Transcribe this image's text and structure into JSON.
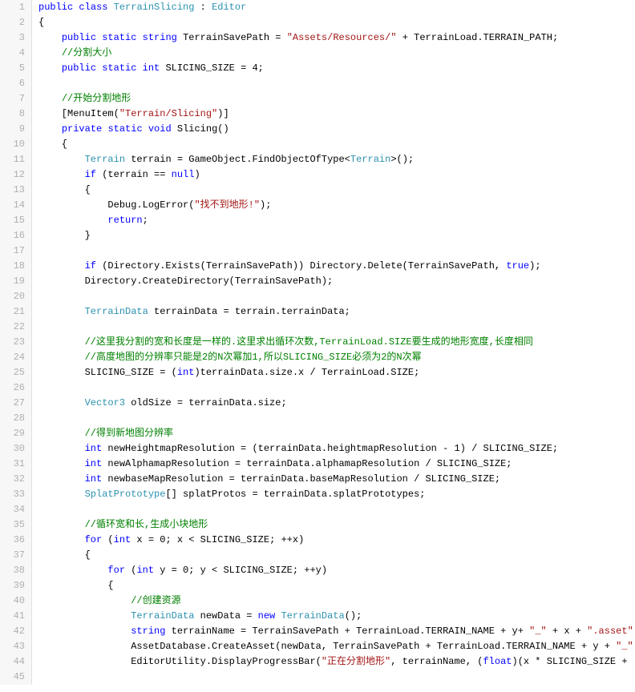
{
  "lines": [
    {
      "num": "1",
      "tokens": [
        {
          "t": "public",
          "c": "kw"
        },
        {
          "t": " "
        },
        {
          "t": "class",
          "c": "kw"
        },
        {
          "t": " "
        },
        {
          "t": "TerrainSlicing",
          "c": "cls"
        },
        {
          "t": " : "
        },
        {
          "t": "Editor",
          "c": "cls"
        }
      ]
    },
    {
      "num": "2",
      "tokens": [
        {
          "t": "{"
        }
      ]
    },
    {
      "num": "3",
      "tokens": [
        {
          "t": "    "
        },
        {
          "t": "public",
          "c": "kw"
        },
        {
          "t": " "
        },
        {
          "t": "static",
          "c": "kw"
        },
        {
          "t": " "
        },
        {
          "t": "string",
          "c": "kw"
        },
        {
          "t": " TerrainSavePath = "
        },
        {
          "t": "\"Assets/Resources/\"",
          "c": "str"
        },
        {
          "t": " + TerrainLoad.TERRAIN_PATH;"
        }
      ]
    },
    {
      "num": "4",
      "tokens": [
        {
          "t": "    "
        },
        {
          "t": "//分割大小",
          "c": "cmt"
        }
      ]
    },
    {
      "num": "5",
      "tokens": [
        {
          "t": "    "
        },
        {
          "t": "public",
          "c": "kw"
        },
        {
          "t": " "
        },
        {
          "t": "static",
          "c": "kw"
        },
        {
          "t": " "
        },
        {
          "t": "int",
          "c": "kw"
        },
        {
          "t": " SLICING_SIZE = 4;"
        }
      ]
    },
    {
      "num": "6",
      "tokens": [
        {
          "t": " "
        }
      ]
    },
    {
      "num": "7",
      "tokens": [
        {
          "t": "    "
        },
        {
          "t": "//开始分割地形",
          "c": "cmt"
        }
      ]
    },
    {
      "num": "8",
      "tokens": [
        {
          "t": "    [MenuItem("
        },
        {
          "t": "\"Terrain/Slicing\"",
          "c": "str"
        },
        {
          "t": ")]"
        }
      ]
    },
    {
      "num": "9",
      "tokens": [
        {
          "t": "    "
        },
        {
          "t": "private",
          "c": "kw"
        },
        {
          "t": " "
        },
        {
          "t": "static",
          "c": "kw"
        },
        {
          "t": " "
        },
        {
          "t": "void",
          "c": "kw"
        },
        {
          "t": " Slicing()"
        }
      ]
    },
    {
      "num": "10",
      "tokens": [
        {
          "t": "    {"
        }
      ]
    },
    {
      "num": "11",
      "tokens": [
        {
          "t": "        "
        },
        {
          "t": "Terrain",
          "c": "cls"
        },
        {
          "t": " terrain = GameObject.FindObjectOfType<"
        },
        {
          "t": "Terrain",
          "c": "cls"
        },
        {
          "t": ">();"
        }
      ]
    },
    {
      "num": "12",
      "tokens": [
        {
          "t": "        "
        },
        {
          "t": "if",
          "c": "kw"
        },
        {
          "t": " (terrain == "
        },
        {
          "t": "null",
          "c": "kw"
        },
        {
          "t": ")"
        }
      ]
    },
    {
      "num": "13",
      "tokens": [
        {
          "t": "        {"
        }
      ]
    },
    {
      "num": "14",
      "tokens": [
        {
          "t": "            Debug.LogError("
        },
        {
          "t": "\"找不到地形!\"",
          "c": "str"
        },
        {
          "t": ");"
        }
      ]
    },
    {
      "num": "15",
      "tokens": [
        {
          "t": "            "
        },
        {
          "t": "return",
          "c": "kw"
        },
        {
          "t": ";"
        }
      ]
    },
    {
      "num": "16",
      "tokens": [
        {
          "t": "        }"
        }
      ]
    },
    {
      "num": "17",
      "tokens": [
        {
          "t": " "
        }
      ]
    },
    {
      "num": "18",
      "tokens": [
        {
          "t": "        "
        },
        {
          "t": "if",
          "c": "kw"
        },
        {
          "t": " (Directory.Exists(TerrainSavePath)) Directory.Delete(TerrainSavePath, "
        },
        {
          "t": "true",
          "c": "kw"
        },
        {
          "t": ");"
        }
      ]
    },
    {
      "num": "19",
      "tokens": [
        {
          "t": "        Directory.CreateDirectory(TerrainSavePath);"
        }
      ]
    },
    {
      "num": "20",
      "tokens": [
        {
          "t": " "
        }
      ]
    },
    {
      "num": "21",
      "tokens": [
        {
          "t": "        "
        },
        {
          "t": "TerrainData",
          "c": "cls"
        },
        {
          "t": " terrainData = terrain.terrainData;"
        }
      ]
    },
    {
      "num": "22",
      "tokens": [
        {
          "t": " "
        }
      ]
    },
    {
      "num": "23",
      "tokens": [
        {
          "t": "        "
        },
        {
          "t": "//这里我分割的宽和长度是一样的.这里求出循环次数,TerrainLoad.SIZE要生成的地形宽度,长度相同",
          "c": "cmt"
        }
      ]
    },
    {
      "num": "24",
      "tokens": [
        {
          "t": "        "
        },
        {
          "t": "//高度地图的分辨率只能是2的N次幂加1,所以SLICING_SIZE必须为2的N次幂",
          "c": "cmt"
        }
      ]
    },
    {
      "num": "25",
      "tokens": [
        {
          "t": "        SLICING_SIZE = ("
        },
        {
          "t": "int",
          "c": "kw"
        },
        {
          "t": ")terrainData.size.x / TerrainLoad.SIZE;"
        }
      ]
    },
    {
      "num": "26",
      "tokens": [
        {
          "t": " "
        }
      ]
    },
    {
      "num": "27",
      "tokens": [
        {
          "t": "        "
        },
        {
          "t": "Vector3",
          "c": "cls"
        },
        {
          "t": " oldSize = terrainData.size;"
        }
      ]
    },
    {
      "num": "28",
      "tokens": [
        {
          "t": " "
        }
      ]
    },
    {
      "num": "29",
      "tokens": [
        {
          "t": "        "
        },
        {
          "t": "//得到新地图分辨率",
          "c": "cmt"
        }
      ]
    },
    {
      "num": "30",
      "tokens": [
        {
          "t": "        "
        },
        {
          "t": "int",
          "c": "kw"
        },
        {
          "t": " newHeightmapResolution = (terrainData.heightmapResolution - 1) / SLICING_SIZE;"
        }
      ]
    },
    {
      "num": "31",
      "tokens": [
        {
          "t": "        "
        },
        {
          "t": "int",
          "c": "kw"
        },
        {
          "t": " newAlphamapResolution = terrainData.alphamapResolution / SLICING_SIZE;"
        }
      ]
    },
    {
      "num": "32",
      "tokens": [
        {
          "t": "        "
        },
        {
          "t": "int",
          "c": "kw"
        },
        {
          "t": " newbaseMapResolution = terrainData.baseMapResolution / SLICING_SIZE;"
        }
      ]
    },
    {
      "num": "33",
      "tokens": [
        {
          "t": "        "
        },
        {
          "t": "SplatPrototype",
          "c": "cls"
        },
        {
          "t": "[] splatProtos = terrainData.splatPrototypes;"
        }
      ]
    },
    {
      "num": "34",
      "tokens": [
        {
          "t": " "
        }
      ]
    },
    {
      "num": "35",
      "tokens": [
        {
          "t": "        "
        },
        {
          "t": "//循环宽和长,生成小块地形",
          "c": "cmt"
        }
      ]
    },
    {
      "num": "36",
      "tokens": [
        {
          "t": "        "
        },
        {
          "t": "for",
          "c": "kw"
        },
        {
          "t": " ("
        },
        {
          "t": "int",
          "c": "kw"
        },
        {
          "t": " x = 0; x < SLICING_SIZE; ++x)"
        }
      ]
    },
    {
      "num": "37",
      "tokens": [
        {
          "t": "        {"
        }
      ]
    },
    {
      "num": "38",
      "tokens": [
        {
          "t": "            "
        },
        {
          "t": "for",
          "c": "kw"
        },
        {
          "t": " ("
        },
        {
          "t": "int",
          "c": "kw"
        },
        {
          "t": " y = 0; y < SLICING_SIZE; ++y)"
        }
      ]
    },
    {
      "num": "39",
      "tokens": [
        {
          "t": "            {"
        }
      ]
    },
    {
      "num": "40",
      "tokens": [
        {
          "t": "                "
        },
        {
          "t": "//创建资源",
          "c": "cmt"
        }
      ]
    },
    {
      "num": "41",
      "tokens": [
        {
          "t": "                "
        },
        {
          "t": "TerrainData",
          "c": "cls"
        },
        {
          "t": " newData = "
        },
        {
          "t": "new",
          "c": "kw"
        },
        {
          "t": " "
        },
        {
          "t": "TerrainData",
          "c": "cls"
        },
        {
          "t": "();"
        }
      ]
    },
    {
      "num": "42",
      "tokens": [
        {
          "t": "                "
        },
        {
          "t": "string",
          "c": "kw"
        },
        {
          "t": " terrainName = TerrainSavePath + TerrainLoad.TERRAIN_NAME + y+ "
        },
        {
          "t": "\"_\"",
          "c": "str"
        },
        {
          "t": " + x + "
        },
        {
          "t": "\".asset\"",
          "c": "str"
        }
      ]
    },
    {
      "num": "43",
      "tokens": [
        {
          "t": "                AssetDatabase.CreateAsset(newData, TerrainSavePath + TerrainLoad.TERRAIN_NAME + y + "
        },
        {
          "t": "\"_\"",
          "c": "str"
        }
      ]
    },
    {
      "num": "44",
      "tokens": [
        {
          "t": "                EditorUtility.DisplayProgressBar("
        },
        {
          "t": "\"正在分割地形\"",
          "c": "str"
        },
        {
          "t": ", terrainName, ("
        },
        {
          "t": "float",
          "c": "kw"
        },
        {
          "t": ")(x * SLICING_SIZE +"
        }
      ]
    },
    {
      "num": "45",
      "tokens": [
        {
          "t": " "
        }
      ]
    }
  ]
}
